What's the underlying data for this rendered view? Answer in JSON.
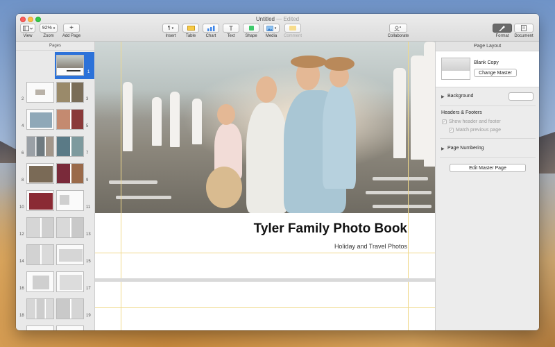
{
  "window": {
    "title": "Untitled",
    "title_suffix": "— Edited"
  },
  "toolbar": {
    "view_label": "View",
    "zoom_value": "92%",
    "zoom_label": "Zoom",
    "add_page_label": "Add Page",
    "insert_label": "Insert",
    "table_label": "Table",
    "chart_label": "Chart",
    "text_label": "Text",
    "shape_label": "Shape",
    "media_label": "Media",
    "comment_label": "Comment",
    "collaborate_label": "Collaborate",
    "format_label": "Format",
    "document_label": "Document"
  },
  "sidebar": {
    "header": "Pages",
    "page_numbers": [
      "1",
      "2",
      "3",
      "4",
      "5",
      "6",
      "7",
      "8",
      "9",
      "10",
      "11",
      "12",
      "13",
      "14",
      "15",
      "16",
      "17",
      "18",
      "19"
    ]
  },
  "canvas": {
    "title": "Tyler Family Photo Book",
    "subtitle": "Holiday and Travel Photos"
  },
  "inspector": {
    "header": "Page Layout",
    "master_name": "Blank Copy",
    "change_master_label": "Change Master",
    "background_label": "Background",
    "headers_footers_title": "Headers & Footers",
    "show_header_footer_label": "Show header and footer",
    "match_previous_label": "Match previous page",
    "page_numbering_label": "Page Numbering",
    "edit_master_label": "Edit Master Page"
  },
  "colors": {
    "accent": "#2c72d9",
    "guide": "#f0d98a"
  }
}
